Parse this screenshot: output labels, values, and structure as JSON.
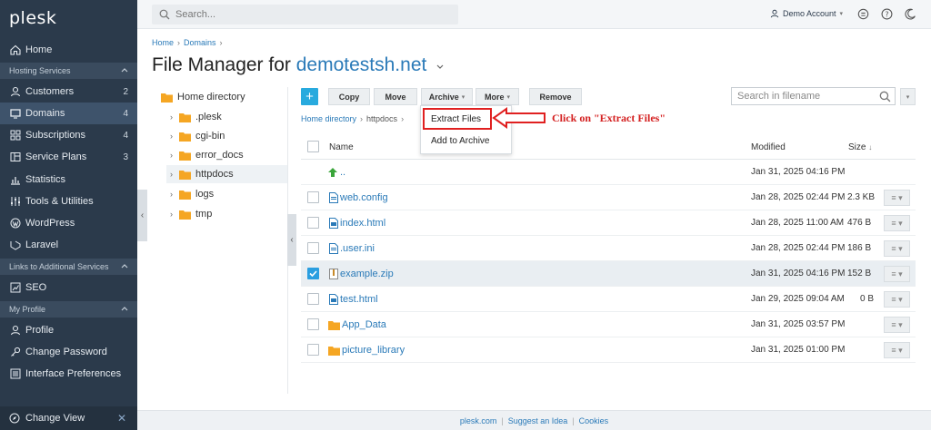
{
  "sidebar": {
    "logo": "plesk",
    "items": [
      {
        "label": "Home",
        "icon": "home-icon",
        "count": ""
      },
      {
        "label": "Customers",
        "icon": "user-icon",
        "count": "2"
      },
      {
        "label": "Domains",
        "icon": "monitor-icon",
        "count": "4"
      },
      {
        "label": "Subscriptions",
        "icon": "grid-icon",
        "count": "4"
      },
      {
        "label": "Service Plans",
        "icon": "plans-icon",
        "count": "3"
      },
      {
        "label": "Statistics",
        "icon": "chart-icon",
        "count": ""
      },
      {
        "label": "Tools & Utilities",
        "icon": "tools-icon",
        "count": ""
      },
      {
        "label": "WordPress",
        "icon": "wordpress-icon",
        "count": ""
      },
      {
        "label": "Laravel",
        "icon": "laravel-icon",
        "count": ""
      },
      {
        "label": "SEO",
        "icon": "seo-icon",
        "count": ""
      },
      {
        "label": "Profile",
        "icon": "profile-icon",
        "count": ""
      },
      {
        "label": "Change Password",
        "icon": "key-icon",
        "count": ""
      },
      {
        "label": "Interface Preferences",
        "icon": "preferences-icon",
        "count": ""
      }
    ],
    "sections": [
      "Hosting Services",
      "Links to Additional Services",
      "My Profile"
    ],
    "change_view": "Change View"
  },
  "topbar": {
    "search_placeholder": "Search...",
    "account": "Demo Account"
  },
  "breadcrumb": [
    "Home",
    "Domains"
  ],
  "title": {
    "prefix": "File Manager for",
    "domain": "demotestsh.net"
  },
  "tree": [
    "Home directory",
    ".plesk",
    "cgi-bin",
    "error_docs",
    "httpdocs",
    "logs",
    "tmp"
  ],
  "toolbar": {
    "copy": "Copy",
    "move": "Move",
    "archive": "Archive",
    "more": "More",
    "remove": "Remove",
    "search_placeholder": "Search in filename"
  },
  "path": [
    "Home directory",
    "httpdocs"
  ],
  "menu": {
    "extract": "Extract Files",
    "add": "Add to Archive"
  },
  "callout": "Click on \"Extract Files\"",
  "table": {
    "headers": {
      "name": "Name",
      "modified": "Modified",
      "size": "Size"
    },
    "rows": [
      {
        "name": "..",
        "type": "up",
        "modified": "Jan 31, 2025 04:16 PM",
        "size": ""
      },
      {
        "name": "web.config",
        "type": "file",
        "modified": "Jan 28, 2025 02:44 PM",
        "size": "2.3 KB"
      },
      {
        "name": "index.html",
        "type": "html",
        "modified": "Jan 28, 2025 11:00 AM",
        "size": "476 B"
      },
      {
        "name": ".user.ini",
        "type": "file",
        "modified": "Jan 28, 2025 02:44 PM",
        "size": "186 B"
      },
      {
        "name": "example.zip",
        "type": "zip",
        "modified": "Jan 31, 2025 04:16 PM",
        "size": "152 B"
      },
      {
        "name": "test.html",
        "type": "html",
        "modified": "Jan 29, 2025 09:04 AM",
        "size": "0 B"
      },
      {
        "name": "App_Data",
        "type": "folder",
        "modified": "Jan 31, 2025 03:57 PM",
        "size": ""
      },
      {
        "name": "picture_library",
        "type": "folder",
        "modified": "Jan 31, 2025 01:00 PM",
        "size": ""
      }
    ]
  },
  "footer": [
    "plesk.com",
    "Suggest an Idea",
    "Cookies"
  ],
  "colors": {
    "sidebar": "#2b3a4b",
    "accent": "#2a7ab8",
    "folder": "#f5a623",
    "callout": "#d42020"
  }
}
